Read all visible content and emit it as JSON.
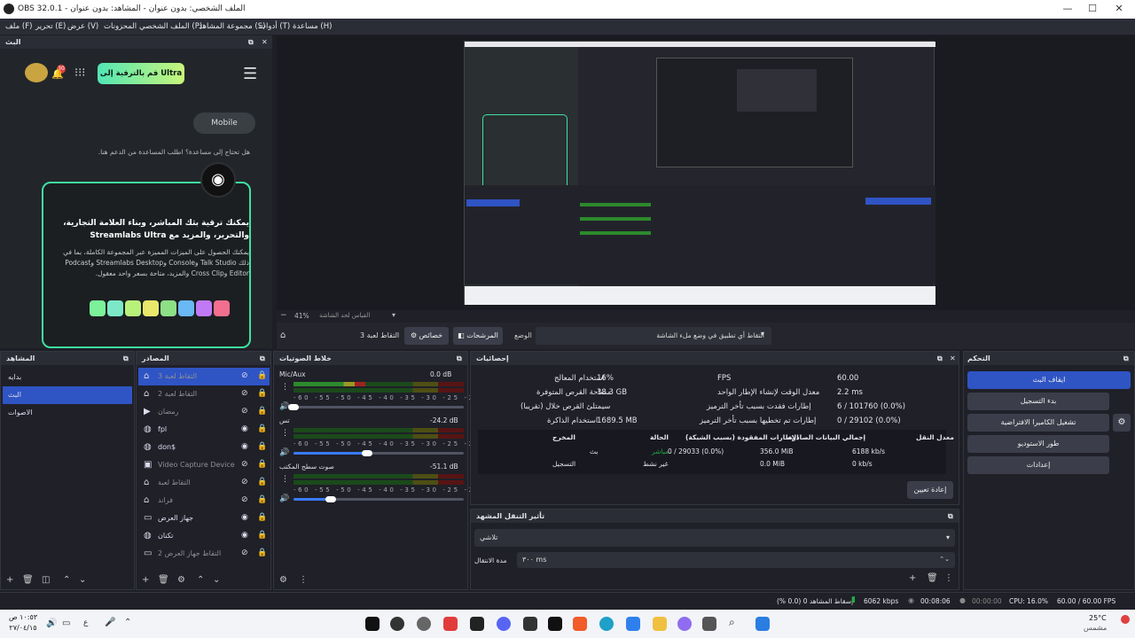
{
  "window": {
    "title": "OBS 32.0.1 - الملف الشخصي: بدون عنوان - المشاهد: بدون عنوان"
  },
  "menu": [
    "ملف (F)",
    "تحرير (E)",
    "عرض (V)",
    "المحزونات",
    "الملف الشخصي (P)",
    "مجموعة المشاهد (S)",
    "أدوات (T)",
    "مساعدة (H)"
  ],
  "browser_dock": {
    "title": "البث",
    "upgrade_btn": "قم بالترقية إلى Ultra",
    "badge": "30",
    "mobile_btn": "Mobile",
    "help_text": "هل تحتاج إلى مساعدة؟ اطلب المساعدة من الدعم هنا.",
    "promo_title": "يمكنك ترقية بثك المباشر، وبناء العلامة التجارية، والتحرير، والمزيد مع Streamlabs Ultra",
    "promo_body": "يمكنك الحصول على الميزات المميزة عبر المجموعة الكاملة، بما في ذلك Talk Studio وConsole وStreamlabs Desktop وPodcast Editor وCross Clip والمزيد، متاحة بسعر واحد معقول."
  },
  "preview": {
    "zoom": "41%",
    "fit_label": "القياس لحد الشاشة"
  },
  "source_toolbar": {
    "source_name": "التقاط لعبة 3",
    "properties": "خصائص",
    "filters": "المرشحات",
    "mode_label": "الوضع",
    "mode_value": "التقاط أي تطبيق في وضع ملء الشاشة"
  },
  "scenes": {
    "title": "المشاهد",
    "items": [
      "بدايه",
      "البث",
      "الاصوات"
    ],
    "selected": 1
  },
  "sources": {
    "title": "المصادر",
    "items": [
      {
        "icon": "game-icon",
        "label": "التقاط لعبة 3",
        "selected": true,
        "dim": true
      },
      {
        "icon": "game-icon",
        "label": "التقاط لعبة 2",
        "dim": true
      },
      {
        "icon": "play-icon",
        "label": "رمضان",
        "dim": true
      },
      {
        "icon": "globe-icon",
        "label": "fpl"
      },
      {
        "icon": "globe-icon",
        "label": "don$"
      },
      {
        "icon": "camera-icon",
        "label": "Video Capture Device",
        "dim": true
      },
      {
        "icon": "game-icon",
        "label": "التقاط لعبة",
        "dim": true
      },
      {
        "icon": "game-icon",
        "label": "فراند",
        "dim": true
      },
      {
        "icon": "monitor-icon",
        "label": "جهاز العرض"
      },
      {
        "icon": "globe-icon",
        "label": "تكنان"
      },
      {
        "icon": "monitor-icon",
        "label": "التقاط جهاز العرض 2",
        "dim": true
      }
    ]
  },
  "mixer": {
    "title": "خلاط الصوتيات",
    "channels": [
      {
        "name": "Mic/Aux",
        "db": "0.0 dB",
        "level": 0.42,
        "volume": 0.0
      },
      {
        "name": "تس",
        "db": "-24.2 dB",
        "level": 0.0,
        "volume": 0.43
      },
      {
        "name": "صوت سطح المكتب",
        "db": "-51.1 dB",
        "level": 0.0,
        "volume": 0.22
      }
    ],
    "scale": "-60 -55 -50 -45 -40 -35 -30 -25 -20 -15 -10 -5 0"
  },
  "stats": {
    "title": "إحصائيات",
    "cpu_label": "استخدام المعالج",
    "cpu_value": "16%",
    "disk_label": "مساحة القرص المتوفرة",
    "disk_value": "38.3 GB",
    "disk_full_label": "سيمتلئ القرص خلال (تقريبا)",
    "disk_full_value": "",
    "mem_label": "استخدام الذاكرة",
    "mem_value": "1689.5 MB",
    "fps_label": "FPS",
    "fps_value": "60.00",
    "render_label": "معدل الوقت لإنشاء الإطار الواحد",
    "render_value": "2.2 ms",
    "lag_label": "إطارات فقدت بسبب تأخر الترميز",
    "lag_value": "6 / 101760 (0.0%)",
    "skip_label": "إطارات تم تخطيها بسبب تأخر الترميز",
    "skip_value": "0 / 29102 (0.0%)",
    "table_headers": [
      "المخرج",
      "الحالة",
      "الإطارات المفقودة (بسبب الشبكة)",
      "إجمالي البيانات الصادرة",
      "معدل النقل"
    ],
    "rows": [
      {
        "out": "بث",
        "status": "مباشر",
        "dropped": "0 / 29033 (0.0%)",
        "total": "356.0 MiB",
        "rate": "6188 kb/s"
      },
      {
        "out": "التسجيل",
        "status": "غير نشط",
        "dropped": "",
        "total": "0.0 MiB",
        "rate": "0 kb/s"
      }
    ],
    "reset": "إعادة تعيين"
  },
  "transition": {
    "title": "تأثير التنقل المشهد",
    "type": "تلاشي",
    "duration_label": "مدة الانتقال",
    "duration": "٣٠٠ ms"
  },
  "controls": {
    "title": "التحكم",
    "stop_stream": "ايقاف البث",
    "start_record": "بدء التسجيل",
    "virtual_cam": "تشغيل الكاميرا الافتراضية",
    "studio": "طور الاستوديو",
    "settings": "إعدادات"
  },
  "statusbar": {
    "dropped": "إسقاط المشاهد 0 (0.0 %)",
    "bitrate": "6062 kbps",
    "stream_time": "00:08:06",
    "rec_time": "00:00:00",
    "cpu": "CPU: 16.0%",
    "fps": "60.00 / 60.00 FPS"
  },
  "taskbar": {
    "time": "١٠:٥٣ ص",
    "date": "٢٧/٠٤/١٥",
    "weather_temp": "25°C",
    "weather_desc": "مشمس",
    "lang": "ع"
  },
  "colors": {
    "accent": "#2f54c4",
    "live": "#22aa44",
    "bg": "#1e1f26"
  }
}
